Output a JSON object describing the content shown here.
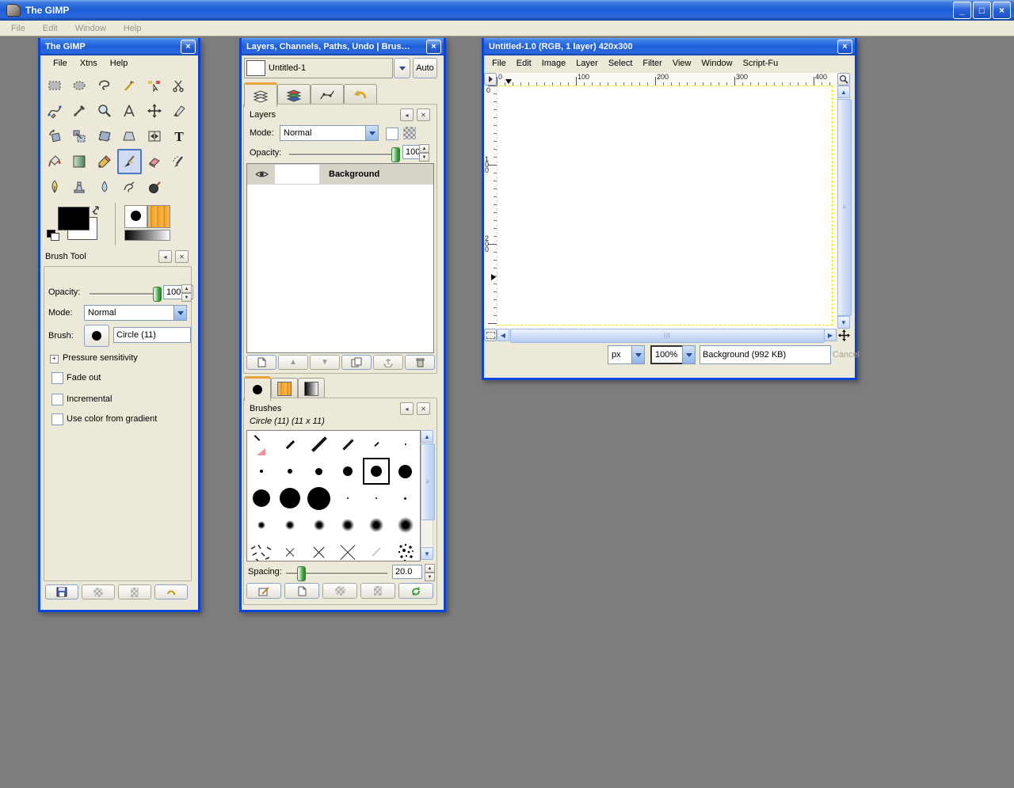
{
  "app": {
    "title": "The GIMP",
    "menu": [
      "File",
      "Edit",
      "Window",
      "Help"
    ],
    "window_buttons": [
      "minimize-icon",
      "maximize-icon",
      "close-icon"
    ]
  },
  "toolbox": {
    "title": "The GIMP",
    "menu": [
      "File",
      "Xtns",
      "Help"
    ],
    "tools": [
      "rectangle-select",
      "ellipse-select",
      "free-select",
      "fuzzy-select",
      "select-by-color",
      "scissors",
      "paths",
      "color-picker",
      "zoom",
      "measure",
      "move",
      "crop",
      "rotate",
      "scale",
      "shear",
      "perspective",
      "flip",
      "text",
      "bucket-fill",
      "gradient",
      "pencil",
      "paintbrush",
      "eraser",
      "airbrush",
      "ink",
      "clone",
      "blur",
      "smudge",
      "dodge-burn"
    ],
    "selected_tool": "paintbrush",
    "foreground_color": "#000000",
    "background_color": "#ffffff",
    "indicators": [
      "brush-indicator",
      "pattern-indicator",
      "gradient-indicator"
    ]
  },
  "tool_options": {
    "title": "Brush Tool",
    "opacity_label": "Opacity:",
    "opacity_value": "100.0",
    "mode_label": "Mode:",
    "mode_value": "Normal",
    "brush_label": "Brush:",
    "brush_value": "Circle (11)",
    "expander_label": "Pressure sensitivity",
    "checkbox_fade": "Fade out",
    "checkbox_incremental": "Incremental",
    "checkbox_gradient": "Use color from gradient",
    "bottom_buttons": [
      "save-icon",
      "restore-icon",
      "delete-icon",
      "reset-icon"
    ]
  },
  "dock": {
    "title": "Layers, Channels, Paths, Undo | Brushes...",
    "image_name": "Untitled-1",
    "auto_label": "Auto",
    "tabs": [
      "layers-tab",
      "channels-tab",
      "paths-tab",
      "undo-history-tab"
    ],
    "layers": {
      "title": "Layers",
      "mode_label": "Mode:",
      "mode_value": "Normal",
      "opacity_label": "Opacity:",
      "opacity_value": "100.0",
      "layer_name": "Background",
      "buttons": [
        "new-layer-icon",
        "raise-layer-icon",
        "lower-layer-icon",
        "duplicate-layer-icon",
        "anchor-layer-icon",
        "delete-layer-icon"
      ]
    },
    "data_tabs": [
      "brushes-tab",
      "patterns-tab",
      "gradients-tab"
    ],
    "brushes": {
      "title": "Brushes",
      "active_brush": "Circle (11) (11 x 11)",
      "spacing_label": "Spacing:",
      "spacing_value": "20.0",
      "buttons": [
        "edit-brush-icon",
        "new-brush-icon",
        "duplicate-brush-icon",
        "delete-brush-icon",
        "refresh-brushes-icon"
      ]
    }
  },
  "image_window": {
    "title": "Untitled-1.0 (RGB, 1 layer) 420x300",
    "menu": [
      "File",
      "Edit",
      "Image",
      "Layer",
      "Select",
      "Filter",
      "View",
      "Window",
      "Script-Fu"
    ],
    "ruler_h": [
      "0",
      "100",
      "200",
      "300",
      "400"
    ],
    "ruler_v": [
      "0",
      "100",
      "200"
    ],
    "unit": "px",
    "zoom": "100%",
    "status": "Background (992 KB)",
    "cancel_label": "Cancel"
  }
}
